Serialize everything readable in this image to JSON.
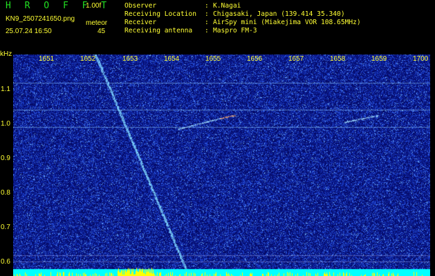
{
  "header": {
    "brand": "H R O F F T",
    "version": "1.00f",
    "file_name": "KN9_2507241650.png",
    "mode": "meteor",
    "timestamp": "25.07.24 16:50",
    "count": "45"
  },
  "station": {
    "rows": [
      {
        "label": "Observer",
        "value": "K.Nagai"
      },
      {
        "label": "Receiving Location",
        "value": "Chigasaki, Japan (139.414 35.340)"
      },
      {
        "label": "Receiver",
        "value": "AirSpy mini (Miakejima VOR 108.65MHz)"
      },
      {
        "label": "Receiving antenna",
        "value": "Maspro FM-3"
      }
    ]
  },
  "plot": {
    "unit_label": "kHz",
    "time_ticks": [
      "1651",
      "1652",
      "1653",
      "1654",
      "1655",
      "1656",
      "1657",
      "1658",
      "1659",
      "1700"
    ],
    "freq_ticks": [
      "1.1",
      "1.0",
      "0.9",
      "0.8",
      "0.7",
      "0.6"
    ],
    "colors": {
      "background": "#000000",
      "noise_dark": "#0a1a8c",
      "noise_light": "#3a6cff",
      "trace": "#7fd4ff",
      "label": "#ffff33",
      "baseline": "#00ffff",
      "spikes": "#ffff00"
    }
  }
}
